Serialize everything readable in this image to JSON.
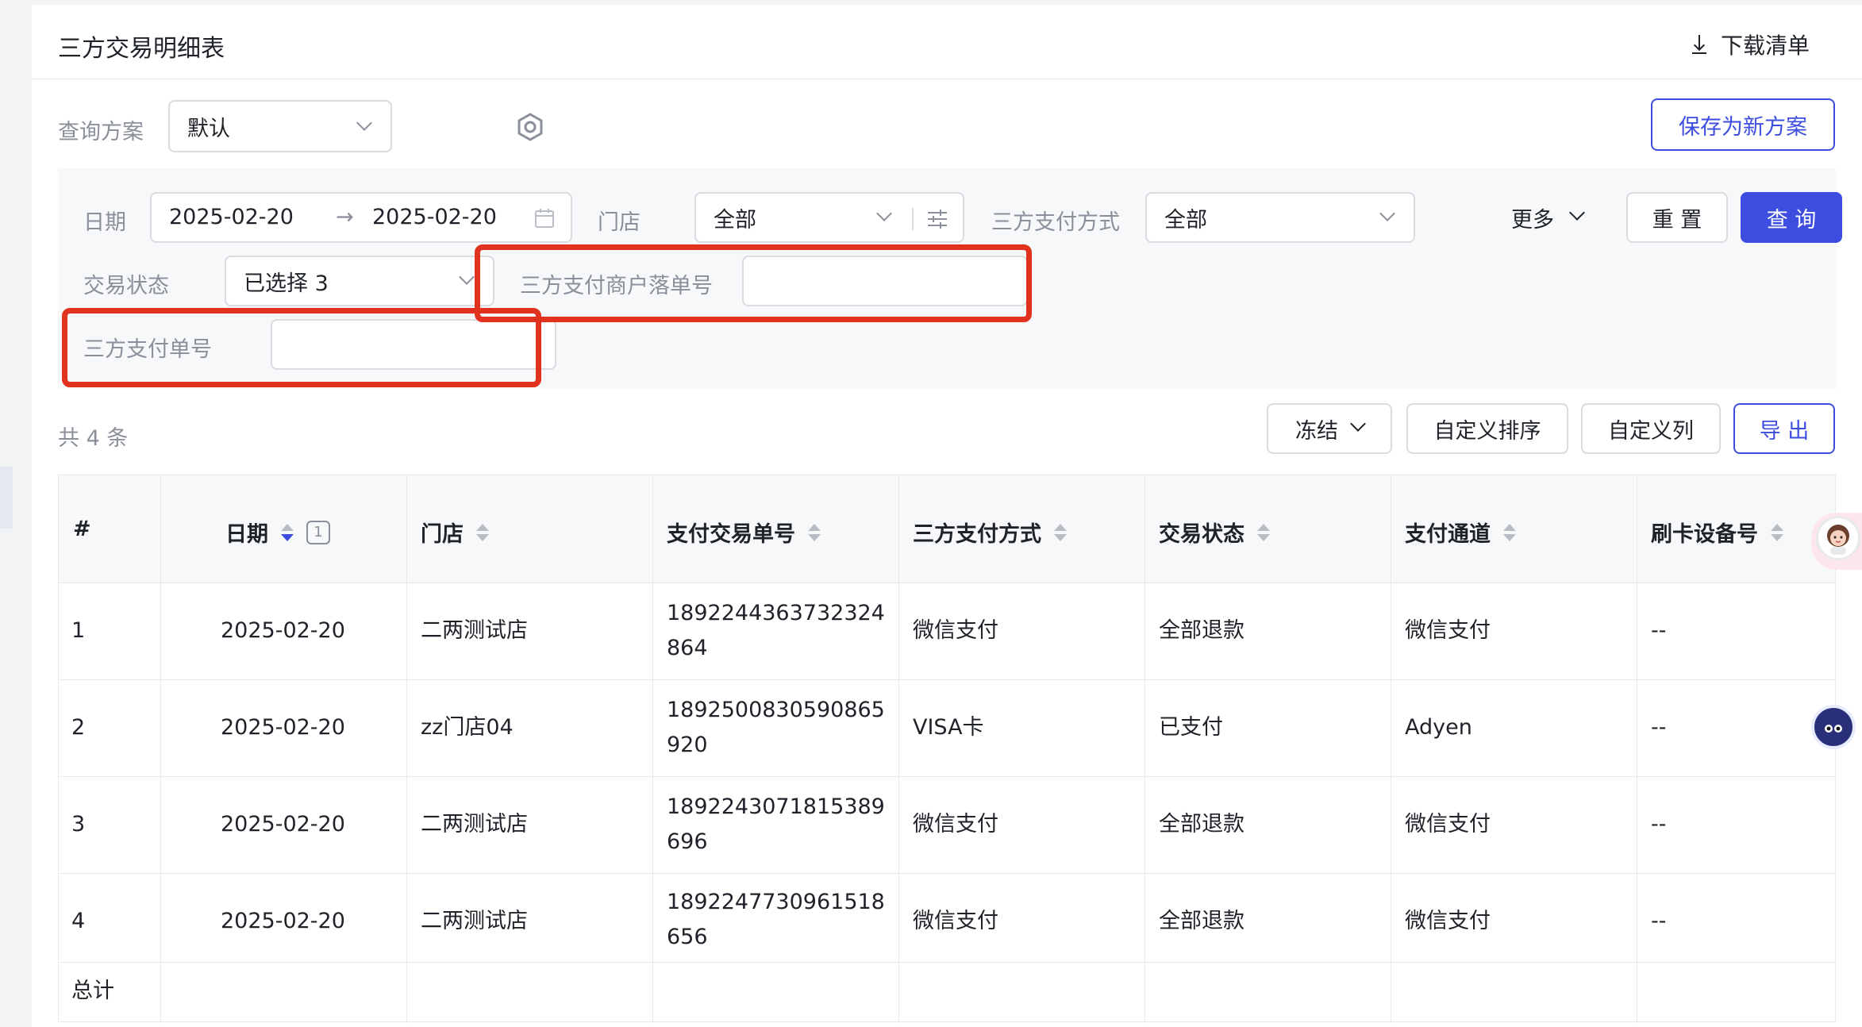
{
  "header": {
    "title": "三方交易明细表",
    "download_label": "下载清单"
  },
  "scheme": {
    "label": "查询方案",
    "value": "默认",
    "save_label": "保存为新方案"
  },
  "filters": {
    "date_label": "日期",
    "date_start": "2025-02-20",
    "date_arrow": "→",
    "date_end": "2025-02-20",
    "store_label": "门店",
    "store_value": "全部",
    "pay_method_label": "三方支付方式",
    "pay_method_value": "全部",
    "more_label": "更多",
    "reset_label": "重 置",
    "query_label": "查 询",
    "status_label": "交易状态",
    "status_value": "已选择 3",
    "merchant_order_label": "三方支付商户落单号",
    "merchant_order_value": "",
    "pay_no_label": "三方支付单号",
    "pay_no_value": ""
  },
  "toolbar": {
    "count_text": "共 4 条",
    "freeze_label": "冻结",
    "sort_label": "自定义排序",
    "columns_label": "自定义列",
    "export_label": "导 出"
  },
  "table": {
    "headers": [
      "#",
      "日期",
      "门店",
      "支付交易单号",
      "三方支付方式",
      "交易状态",
      "支付通道",
      "刷卡设备号"
    ],
    "sort_badge": "1",
    "rows": [
      {
        "no": "1",
        "date": "2025-02-20",
        "store": "二两测试店",
        "txn1": "1892244363732324",
        "txn2": "864",
        "method": "微信支付",
        "status": "全部退款",
        "channel": "微信支付",
        "device": "--"
      },
      {
        "no": "2",
        "date": "2025-02-20",
        "store": "zz门店04",
        "txn1": "1892500830590865",
        "txn2": "920",
        "method": "VISA卡",
        "status": "已支付",
        "channel": "Adyen",
        "device": "--"
      },
      {
        "no": "3",
        "date": "2025-02-20",
        "store": "二两测试店",
        "txn1": "1892243071815389",
        "txn2": "696",
        "method": "微信支付",
        "status": "全部退款",
        "channel": "微信支付",
        "device": "--"
      },
      {
        "no": "4",
        "date": "2025-02-20",
        "store": "二两测试店",
        "txn1": "1892247730961518",
        "txn2": "656",
        "method": "微信支付",
        "status": "全部退款",
        "channel": "微信支付",
        "device": "--"
      }
    ],
    "total_label": "总计"
  },
  "colors": {
    "primary": "#3d4de0",
    "highlight": "#e0321e"
  }
}
